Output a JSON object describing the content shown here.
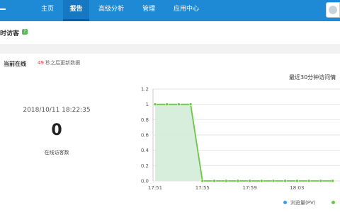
{
  "nav": {
    "items": [
      {
        "label": "主页",
        "active": false
      },
      {
        "label": "报告",
        "active": true
      },
      {
        "label": "高级分析",
        "active": false
      },
      {
        "label": "管理",
        "active": false
      },
      {
        "label": "应用中心",
        "active": false
      }
    ]
  },
  "subheader": {
    "title": "时访客",
    "help_icon_text": "?"
  },
  "realtime": {
    "label": "当前在线",
    "refresh_seconds": "49",
    "refresh_text": " 秒之后更新数据",
    "timestamp": "2018/10/11 18:22:35",
    "online_count": "0",
    "online_label": "在线访客数"
  },
  "chart_data": {
    "type": "area",
    "title": "最近30分钟访问情",
    "x_ticks": [
      "17:51",
      "17:55",
      "17:59",
      "18:03",
      "18"
    ],
    "x": [
      "17:51",
      "17:52",
      "17:53",
      "17:54",
      "17:55",
      "17:56",
      "17:57",
      "17:58",
      "17:59",
      "18:00",
      "18:01",
      "18:02",
      "18:03",
      "18:04",
      "18:05",
      "18:06"
    ],
    "y_ticks": [
      "1.2",
      "1",
      "0.8",
      "0.6",
      "0.4",
      "0.2",
      "0.0"
    ],
    "ylim": [
      0,
      1.2
    ],
    "series": [
      {
        "name": "浏览量(PV)",
        "color": "#3d9be9",
        "values": [
          1,
          1,
          1,
          1,
          0,
          0,
          0,
          0,
          0,
          0,
          0,
          0,
          0,
          0,
          0,
          0
        ]
      }
    ],
    "fill_color": "#d4ecd8",
    "line_color": "#6cc644",
    "grid": true,
    "legend": [
      {
        "name": "浏览量(PV)",
        "color": "#3d9be9"
      },
      {
        "name": "",
        "color": "#6cc644"
      }
    ]
  }
}
